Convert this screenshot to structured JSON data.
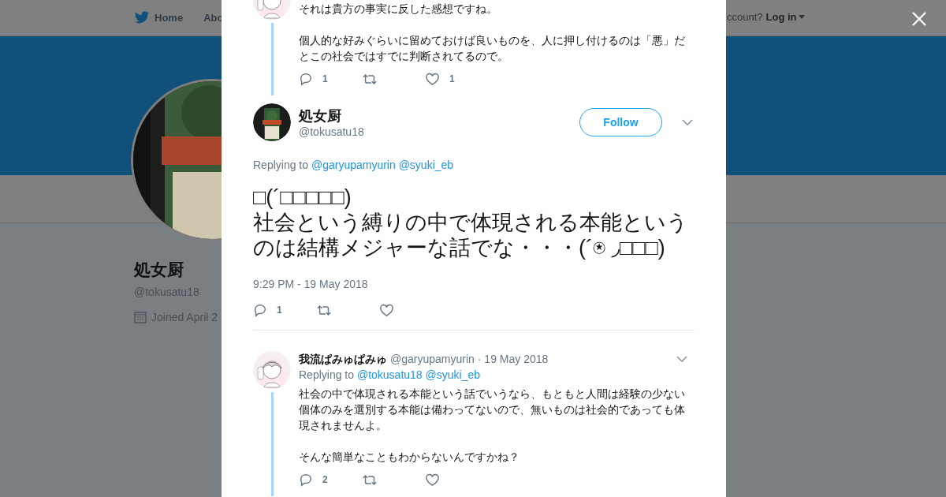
{
  "nav": {
    "items": [
      {
        "label": "Home",
        "kind": "home"
      },
      {
        "label": "Abo",
        "kind": "plain"
      }
    ],
    "account_prompt": "ccount?",
    "login": "Log in"
  },
  "profile": {
    "name": "処女厨",
    "handle": "@tokusatu18",
    "joined": "Joined April 2"
  },
  "tweets": [
    {
      "kind": "thread",
      "paragraphs": [
        "それは貴方の事実に反した感想ですね。",
        "個人的な好みぐらいに留めておけば良いものを、人に押し付けるのは「悪」だとこの社会ではすでに判断されてるので。"
      ],
      "replies": "1",
      "likes": "1"
    },
    {
      "kind": "focus",
      "name": "処女厨",
      "handle": "@tokusatu18",
      "follow": "Follow",
      "replying_label": "Replying to",
      "replying_to": [
        "@garyupamyurin",
        "@syuki_eb"
      ],
      "text": "□(´□□□□□)\n社会という縛りの中で体現される本能というのは結構メジャーな話でな・・・(´⍟ ◞□□□)",
      "timestamp": "9:29 PM - 19 May 2018",
      "replies": "1"
    },
    {
      "kind": "reply",
      "name": "我流ぱみゅぱみゅ",
      "handle": "@garyupamyurin",
      "date": "· 19 May 2018",
      "replying_label": "Replying to",
      "replying_to": [
        "@tokusatu18",
        "@syuki_eb"
      ],
      "paragraphs": [
        "社会の中で体現される本能という話でいうなら、もともと人間は経験の少ない個体のみを選別する本能は備わってないので、無いものは社会的であっても体現されませんよ。",
        "そんな簡単なこともわからないんですかね？"
      ],
      "replies": "2"
    }
  ]
}
